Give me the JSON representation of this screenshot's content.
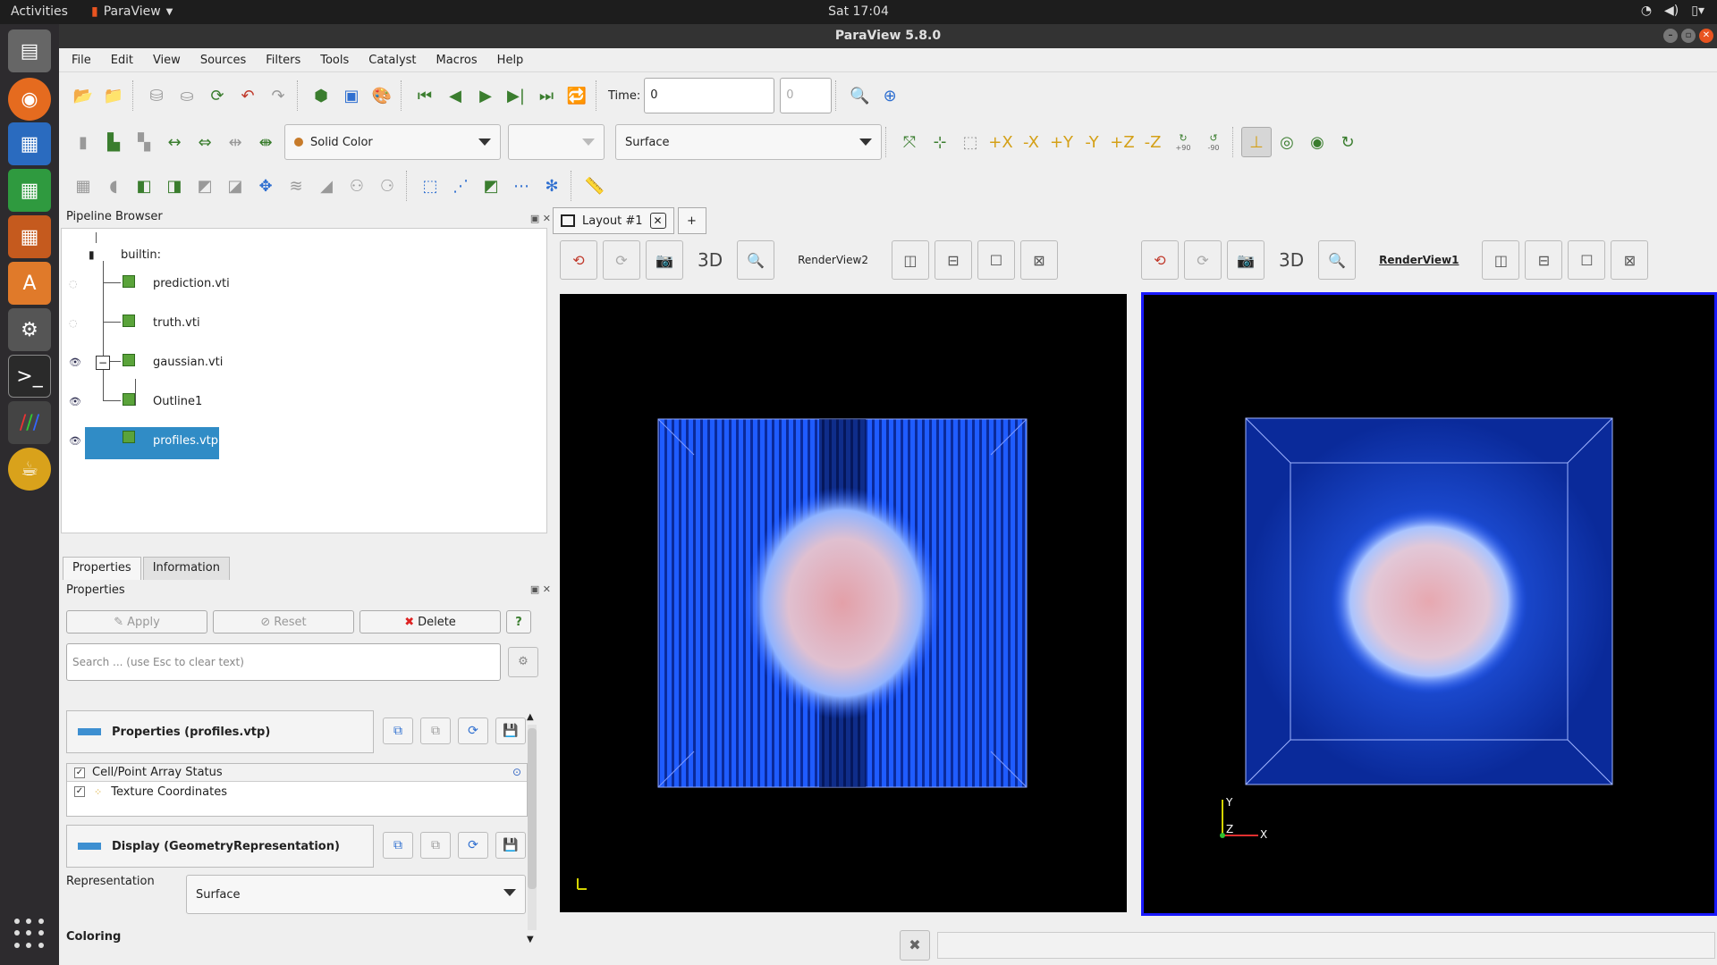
{
  "topbar": {
    "activities": "Activities",
    "app_name": "ParaView",
    "clock": "Sat 17:04"
  },
  "window": {
    "title": "ParaView 5.8.0"
  },
  "menu": [
    "File",
    "Edit",
    "View",
    "Sources",
    "Filters",
    "Tools",
    "Catalyst",
    "Macros",
    "Help"
  ],
  "toolbar": {
    "time_label": "Time:",
    "time_value": "0",
    "timestep_value": "0",
    "color_combo": "Solid Color",
    "representation_combo": "Surface",
    "camera_rot_plus": "+90",
    "camera_rot_minus": "-90"
  },
  "pipeline": {
    "title": "Pipeline Browser",
    "root": "builtin:",
    "items": [
      {
        "label": "prediction.vti"
      },
      {
        "label": "truth.vti"
      },
      {
        "label": "gaussian.vti"
      },
      {
        "label": "Outline1"
      },
      {
        "label": "profiles.vtp"
      }
    ]
  },
  "tabs": {
    "properties": "Properties",
    "information": "Information"
  },
  "properties": {
    "title": "Properties",
    "apply": "Apply",
    "reset": "Reset",
    "delete": "Delete",
    "help": "?",
    "search_placeholder": "Search ... (use Esc to clear text)",
    "section1": "Properties (profiles.vtp)",
    "array_header": "Cell/Point Array Status",
    "array_item": "Texture Coordinates",
    "section2": "Display (GeometryRepresentation)",
    "representation_label": "Representation",
    "representation_value": "Surface",
    "coloring": "Coloring"
  },
  "layout": {
    "tab": "Layout #1",
    "add": "+",
    "view2_name": "RenderView2",
    "view1_name": "RenderView1",
    "mode_3d": "3D"
  },
  "axes": {
    "y": "Y",
    "z": "Z",
    "x": "X"
  },
  "colors": {
    "accent": "#308cc6",
    "active_view_border": "#1a1aff",
    "ubuntu_orange": "#e95420"
  }
}
